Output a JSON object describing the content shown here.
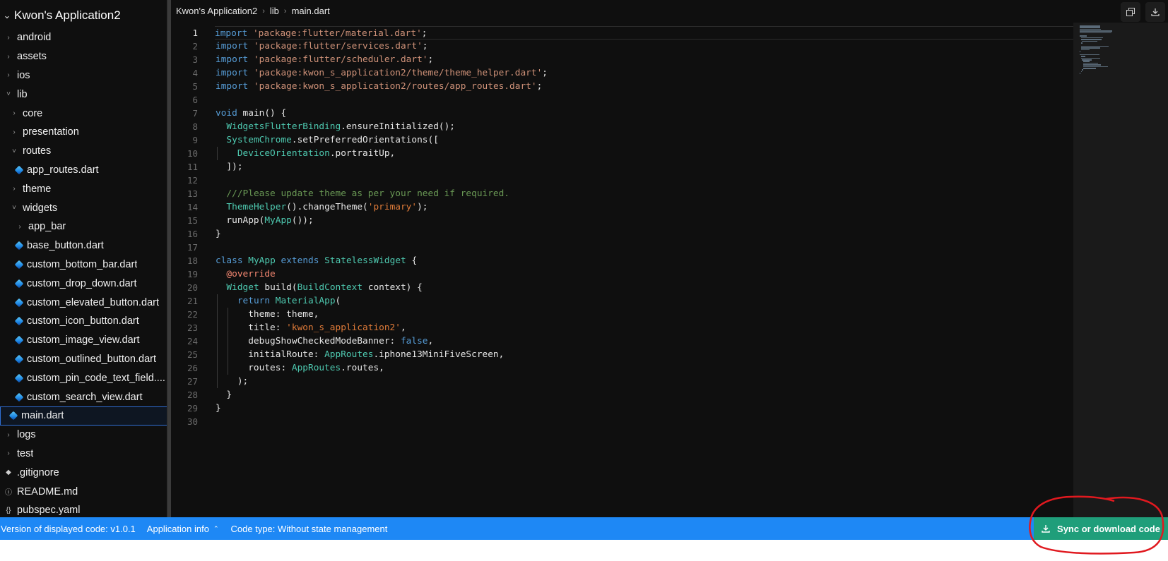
{
  "sidebar": {
    "project_title": "Kwon's Application2",
    "items": [
      {
        "label": "android",
        "type": "folder",
        "open": false,
        "depth": 0
      },
      {
        "label": "assets",
        "type": "folder",
        "open": false,
        "depth": 0
      },
      {
        "label": "ios",
        "type": "folder",
        "open": false,
        "depth": 0
      },
      {
        "label": "lib",
        "type": "folder",
        "open": true,
        "depth": 0
      },
      {
        "label": "core",
        "type": "folder",
        "open": false,
        "depth": 1
      },
      {
        "label": "presentation",
        "type": "folder",
        "open": false,
        "depth": 1
      },
      {
        "label": "routes",
        "type": "folder",
        "open": true,
        "depth": 1
      },
      {
        "label": "app_routes.dart",
        "type": "dart",
        "depth": 2
      },
      {
        "label": "theme",
        "type": "folder",
        "open": false,
        "depth": 1
      },
      {
        "label": "widgets",
        "type": "folder",
        "open": true,
        "depth": 1
      },
      {
        "label": "app_bar",
        "type": "folder",
        "open": false,
        "depth": 2
      },
      {
        "label": "base_button.dart",
        "type": "dart",
        "depth": 2
      },
      {
        "label": "custom_bottom_bar.dart",
        "type": "dart",
        "depth": 2
      },
      {
        "label": "custom_drop_down.dart",
        "type": "dart",
        "depth": 2
      },
      {
        "label": "custom_elevated_button.dart",
        "type": "dart",
        "depth": 2
      },
      {
        "label": "custom_icon_button.dart",
        "type": "dart",
        "depth": 2
      },
      {
        "label": "custom_image_view.dart",
        "type": "dart",
        "depth": 2
      },
      {
        "label": "custom_outlined_button.dart",
        "type": "dart",
        "depth": 2
      },
      {
        "label": "custom_pin_code_text_field....",
        "type": "dart",
        "depth": 2
      },
      {
        "label": "custom_search_view.dart",
        "type": "dart",
        "depth": 2
      },
      {
        "label": "main.dart",
        "type": "dart",
        "depth": 1,
        "selected": true
      },
      {
        "label": "logs",
        "type": "folder",
        "open": false,
        "depth": 0
      },
      {
        "label": "test",
        "type": "folder",
        "open": false,
        "depth": 0
      },
      {
        "label": ".gitignore",
        "type": "gitignore",
        "depth": 0
      },
      {
        "label": "README.md",
        "type": "info",
        "depth": 0
      },
      {
        "label": "pubspec.yaml",
        "type": "yaml",
        "depth": 0
      }
    ]
  },
  "breadcrumb": [
    "Kwon's Application2",
    "lib",
    "main.dart"
  ],
  "toolbar": {
    "copy_icon": "copy-icon",
    "download_icon": "download-icon"
  },
  "editor": {
    "active_line": 1,
    "lines": [
      [
        [
          "kw",
          "import"
        ],
        [
          "txt",
          " "
        ],
        [
          "str",
          "'package:flutter/material.dart'"
        ],
        [
          "txt",
          ";"
        ]
      ],
      [
        [
          "kw",
          "import"
        ],
        [
          "txt",
          " "
        ],
        [
          "str",
          "'package:flutter/services.dart'"
        ],
        [
          "txt",
          ";"
        ]
      ],
      [
        [
          "kw",
          "import"
        ],
        [
          "txt",
          " "
        ],
        [
          "str",
          "'package:flutter/scheduler.dart'"
        ],
        [
          "txt",
          ";"
        ]
      ],
      [
        [
          "kw",
          "import"
        ],
        [
          "txt",
          " "
        ],
        [
          "str",
          "'package:kwon_s_application2/theme/theme_helper.dart'"
        ],
        [
          "txt",
          ";"
        ]
      ],
      [
        [
          "kw",
          "import"
        ],
        [
          "txt",
          " "
        ],
        [
          "str",
          "'package:kwon_s_application2/routes/app_routes.dart'"
        ],
        [
          "txt",
          ";"
        ]
      ],
      [],
      [
        [
          "kw",
          "void"
        ],
        [
          "txt",
          " main() {"
        ]
      ],
      [
        [
          "txt",
          "  "
        ],
        [
          "ty",
          "WidgetsFlutterBinding"
        ],
        [
          "txt",
          ".ensureInitialized();"
        ]
      ],
      [
        [
          "txt",
          "  "
        ],
        [
          "ty",
          "SystemChrome"
        ],
        [
          "txt",
          ".setPreferredOrientations(["
        ]
      ],
      [
        [
          "txt",
          "    "
        ],
        [
          "ty",
          "DeviceOrientation"
        ],
        [
          "txt",
          ".portraitUp,"
        ]
      ],
      [
        [
          "txt",
          "  ]);"
        ]
      ],
      [],
      [
        [
          "txt",
          "  "
        ],
        [
          "cm",
          "///Please update theme as per your need if required."
        ]
      ],
      [
        [
          "txt",
          "  "
        ],
        [
          "ty",
          "ThemeHelper"
        ],
        [
          "txt",
          "().changeTheme("
        ],
        [
          "strsm",
          "'primary'"
        ],
        [
          "txt",
          ");"
        ]
      ],
      [
        [
          "txt",
          "  runApp("
        ],
        [
          "ty",
          "MyApp"
        ],
        [
          "txt",
          "());"
        ]
      ],
      [
        [
          "txt",
          "}"
        ]
      ],
      [],
      [
        [
          "kw",
          "class"
        ],
        [
          "txt",
          " "
        ],
        [
          "ty",
          "MyApp"
        ],
        [
          "txt",
          " "
        ],
        [
          "kw",
          "extends"
        ],
        [
          "txt",
          " "
        ],
        [
          "ty",
          "StatelessWidget"
        ],
        [
          "txt",
          " {"
        ]
      ],
      [
        [
          "txt",
          "  "
        ],
        [
          "an",
          "@override"
        ]
      ],
      [
        [
          "txt",
          "  "
        ],
        [
          "ty",
          "Widget"
        ],
        [
          "txt",
          " build("
        ],
        [
          "ty",
          "BuildContext"
        ],
        [
          "txt",
          " context) {"
        ]
      ],
      [
        [
          "txt",
          "    "
        ],
        [
          "kw",
          "return"
        ],
        [
          "txt",
          " "
        ],
        [
          "ty",
          "MaterialApp"
        ],
        [
          "txt",
          "("
        ]
      ],
      [
        [
          "txt",
          "      theme: theme,"
        ]
      ],
      [
        [
          "txt",
          "      title: "
        ],
        [
          "strsm",
          "'kwon_s_application2'"
        ],
        [
          "txt",
          ","
        ]
      ],
      [
        [
          "txt",
          "      debugShowCheckedModeBanner: "
        ],
        [
          "kw",
          "false"
        ],
        [
          "txt",
          ","
        ]
      ],
      [
        [
          "txt",
          "      initialRoute: "
        ],
        [
          "ty",
          "AppRoutes"
        ],
        [
          "txt",
          ".iphone13MiniFiveScreen,"
        ]
      ],
      [
        [
          "txt",
          "      routes: "
        ],
        [
          "ty",
          "AppRoutes"
        ],
        [
          "txt",
          ".routes,"
        ]
      ],
      [
        [
          "txt",
          "    );"
        ]
      ],
      [
        [
          "txt",
          "  }"
        ]
      ],
      [
        [
          "txt",
          "}"
        ]
      ],
      []
    ]
  },
  "statusbar": {
    "version": "Version of displayed code: v1.0.1",
    "app_info": "Application info",
    "code_type": "Code type: Without state management",
    "sync_button": "Sync or download code"
  },
  "colors": {
    "status_bar": "#1e88f5",
    "sync_button": "#1f9e7a",
    "annotation": "#e0191f",
    "editor_bg": "#0f0f0f"
  }
}
